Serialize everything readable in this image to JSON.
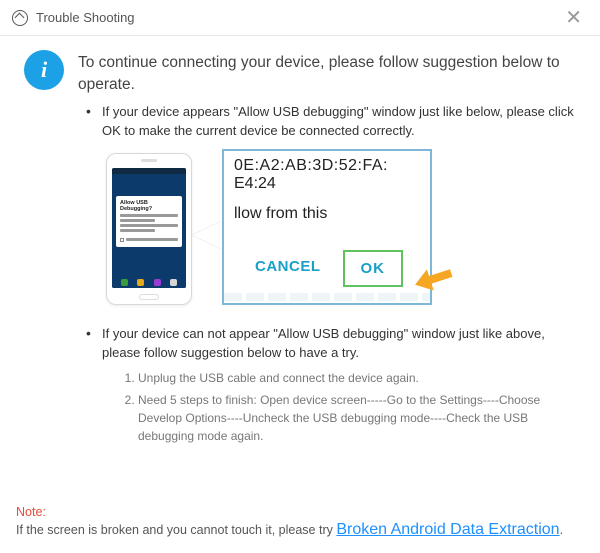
{
  "titlebar": {
    "title": "Trouble Shooting"
  },
  "heading": "To continue connecting your device, please follow suggestion below to operate.",
  "bullets": [
    {
      "text": "If your device appears \"Allow USB debugging\" window just like below, please click OK to make the current device  be connected correctly."
    },
    {
      "text": "If your device can not appear \"Allow USB debugging\" window just like above, please follow suggestion below to have a try."
    }
  ],
  "illustration": {
    "phone_dialog_title": "Allow USB Debugging?",
    "mac_line1": "0E:A2:AB:3D:52:FA:",
    "mac_line2": "E4:24",
    "allow_text": "llow from this",
    "cancel_label": "CANCEL",
    "ok_label": "OK"
  },
  "steps": [
    "Unplug the USB cable and connect the device again.",
    "Need 5 steps to finish: Open device screen-----Go to the Settings----Choose Develop Options----Uncheck the USB debugging mode----Check the USB debugging mode again."
  ],
  "note": {
    "label": "Note:",
    "text": "If the screen is broken and you cannot touch it, please try ",
    "link": "Broken Android Data Extraction",
    "tail": "."
  }
}
